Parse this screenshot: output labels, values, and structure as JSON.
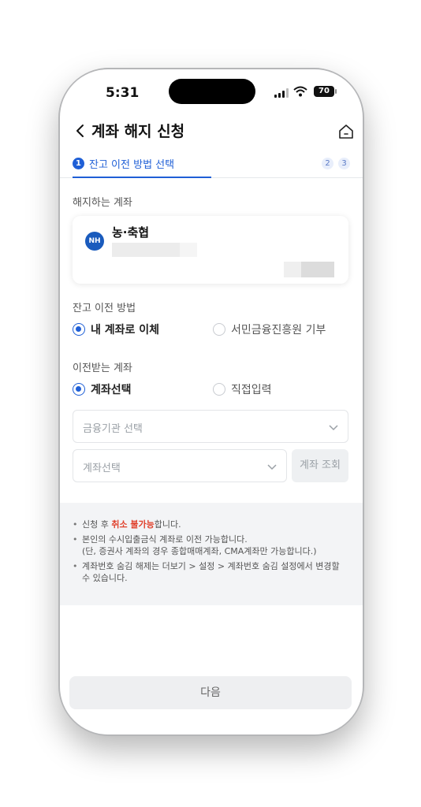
{
  "status": {
    "time": "5:31",
    "battery": "70"
  },
  "header": {
    "title": "계좌 해지 신청",
    "back_icon": "chevron-left-icon",
    "home_icon": "home-icon"
  },
  "steps": {
    "active_num": "1",
    "active_label": "잔고 이전 방법 선택",
    "others": [
      "2",
      "3"
    ],
    "accent": "#1f5fd6"
  },
  "closing_account": {
    "label": "해지하는 계좌",
    "bank_logo": "NH",
    "bank_name": "농·축협"
  },
  "transfer_method": {
    "label": "잔고 이전 방법",
    "options": [
      {
        "label": "내 계좌로 이체",
        "selected": true
      },
      {
        "label": "서민금융진흥원 기부",
        "selected": false
      }
    ]
  },
  "receiving": {
    "label": "이전받는 계좌",
    "options": [
      {
        "label": "계좌선택",
        "selected": true
      },
      {
        "label": "직접입력",
        "selected": false
      }
    ],
    "institution_placeholder": "금융기관 선택",
    "account_placeholder": "계좌선택",
    "lookup_button": "계좌 조회"
  },
  "notices": {
    "n1_pre": "신청 후 ",
    "n1_warn": "취소 불가능",
    "n1_post": "합니다.",
    "n2_line1": "본인의 수시입출금식 계좌로 이전 가능합니다.",
    "n2_line2": "(단, 증권사 계좌의 경우 종합매매계좌, CMA계좌만 가능합니다.)",
    "n3": "계좌번호 숨김 해제는 더보기 > 설정 > 계좌번호 숨김 설정에서 변경할 수 있습니다."
  },
  "footer": {
    "next_button": "다음"
  }
}
